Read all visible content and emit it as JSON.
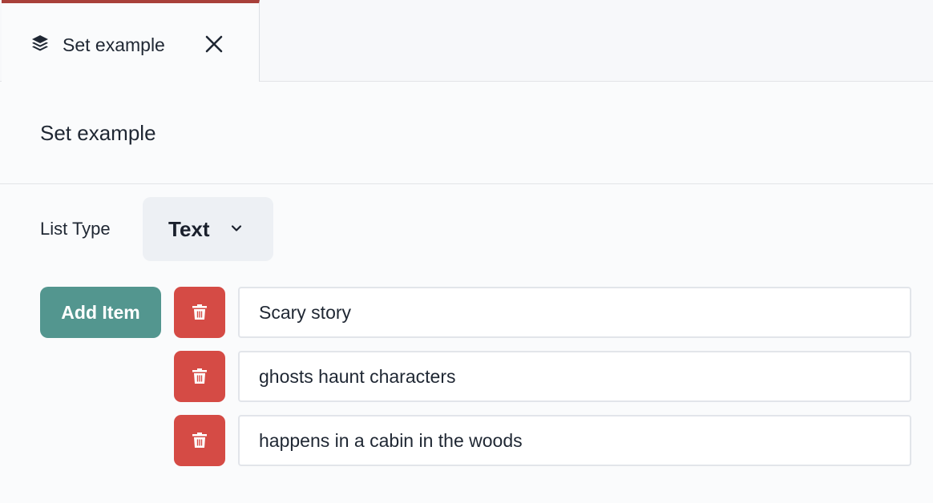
{
  "tab": {
    "title": "Set example",
    "icon": "layers-icon",
    "close_icon": "close-icon",
    "accent_color": "#a8403a"
  },
  "panel": {
    "title": "Set example"
  },
  "list_type": {
    "label": "List Type",
    "selected": "Text",
    "icon": "chevron-down-icon"
  },
  "add_item": {
    "label": "Add Item",
    "color": "#53968f"
  },
  "items": [
    {
      "value": "Scary story",
      "delete_icon": "trash-icon"
    },
    {
      "value": "ghosts haunt characters",
      "delete_icon": "trash-icon"
    },
    {
      "value": "happens in a cabin in the woods",
      "delete_icon": "trash-icon"
    }
  ],
  "delete_color": "#d54b45"
}
